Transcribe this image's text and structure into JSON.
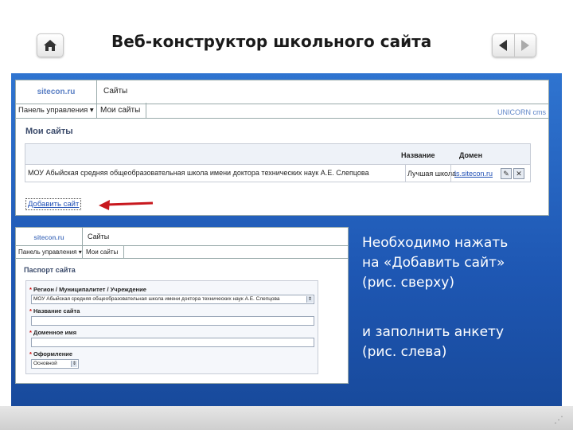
{
  "slide": {
    "title": "Веб-конструктор школьного сайта"
  },
  "shot1": {
    "logo": "sitecon.ru",
    "header_title": "Сайты",
    "tab_panel": "Панель управления ▾",
    "tab_sites": "Мои сайты",
    "unicorn": "UNICORN cms",
    "section_title": "Мои сайты",
    "table": {
      "columns": [
        "Название",
        "Домен"
      ],
      "rows": [
        {
          "school": "МОУ Абыйская средняя общеобразовательная школа имени доктора технических наук А.Е. Слепцова",
          "name": "Лучшая школа",
          "domain": "ls.sitecon.ru"
        }
      ]
    },
    "add_site": "Добавить сайт"
  },
  "shot2": {
    "logo": "sitecon.ru",
    "header_title": "Сайты",
    "tab_panel": "Панель управления ▾",
    "tab_sites": "Мои сайты",
    "section_title": "Паспорт сайта",
    "fields": {
      "region_label": "Регион / Муниципалитет / Учреждение",
      "region_value": "МОУ Абыйская средняя общеобразовательная школа имени доктора технических наук А.Е. Слепцова",
      "name_label": "Название сайта",
      "domain_label": "Доменное имя",
      "design_label": "Оформление",
      "design_value": "Основной"
    }
  },
  "instructions": {
    "line1": "Необходимо нажать",
    "line2": "на «Добавить сайт»",
    "line3": "(рис. сверху)",
    "line4": "и заполнить анкету",
    "line5": "(рис. слева)"
  },
  "colors": {
    "slide_blue": "#1e57b3",
    "link_blue": "#1f4fb5",
    "arrow_red": "#c8181e"
  }
}
